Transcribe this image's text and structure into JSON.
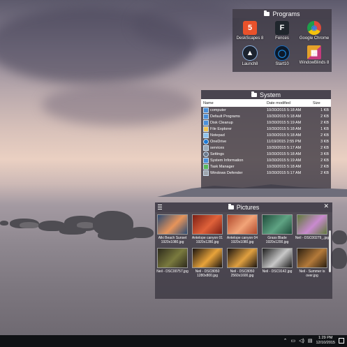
{
  "colors": {
    "fence_bg": "#3a3640",
    "taskbar": "#101215"
  },
  "programs": {
    "title": "Programs",
    "items": [
      {
        "label": "DeskScapes 8",
        "icon": "deskscapes-icon",
        "color": "#e9522b",
        "glyph": "5"
      },
      {
        "label": "Fences",
        "icon": "fences-icon",
        "color": "#20262d",
        "glyph": "F"
      },
      {
        "label": "Google Chrome",
        "icon": "chrome-icon",
        "color": "#de4a3a",
        "glyph": "◉"
      },
      {
        "label": "Launch8",
        "icon": "launch8-icon",
        "color": "#1d2430",
        "glyph": "▲"
      },
      {
        "label": "Start10",
        "icon": "start10-icon",
        "color": "#1b6ec2",
        "glyph": "◯"
      },
      {
        "label": "WindowBlinds 8",
        "icon": "windowblinds-icon",
        "color": "#e5a22a",
        "glyph": "▦"
      }
    ]
  },
  "system": {
    "title": "System",
    "columns": [
      "Name",
      "Date modified",
      "Size"
    ],
    "rows": [
      {
        "name": "computer",
        "date": "10/30/2015 5:18 AM",
        "size": "1 KB"
      },
      {
        "name": "Default Programs",
        "date": "10/30/2015 5:18 AM",
        "size": "2 KB"
      },
      {
        "name": "Disk Cleanup",
        "date": "10/30/2015 5:19 AM",
        "size": "2 KB"
      },
      {
        "name": "File Explorer",
        "date": "10/30/2015 5:18 AM",
        "size": "1 KB"
      },
      {
        "name": "Notepad",
        "date": "10/30/2015 5:18 AM",
        "size": "2 KB"
      },
      {
        "name": "OneDrive",
        "date": "11/19/2015 2:55 PM",
        "size": "3 KB"
      },
      {
        "name": "services",
        "date": "10/30/2015 5:17 AM",
        "size": "2 KB"
      },
      {
        "name": "Settings",
        "date": "10/30/2015 5:18 AM",
        "size": "3 KB"
      },
      {
        "name": "System Information",
        "date": "10/30/2015 5:19 AM",
        "size": "2 KB"
      },
      {
        "name": "Task Manager",
        "date": "10/30/2015 5:18 AM",
        "size": "2 KB"
      },
      {
        "name": "Windows Defender",
        "date": "10/30/2015 5:17 AM",
        "size": "2 KB"
      }
    ]
  },
  "pictures": {
    "title": "Pictures",
    "items": [
      {
        "label": "Alki Beach Sunset 1920x1080.jpg",
        "c1": "#2a4b74",
        "c2": "#e7945a"
      },
      {
        "label": "Antelope canyon 01 1920x1280.jpg",
        "c1": "#7a1e14",
        "c2": "#e0623a"
      },
      {
        "label": "Antelope canyon 04 1920x1080.jpg",
        "c1": "#b0482c",
        "c2": "#f2a478"
      },
      {
        "label": "Grass Blade 1920x1200.jpg",
        "c1": "#1e4a3a",
        "c2": "#5fa383"
      },
      {
        "label": "Neil - DSC00279_.jpg",
        "c1": "#5f7a3a",
        "c2": "#c98ad0"
      },
      {
        "label": "Neil - DSC00757.jpg",
        "c1": "#2d2a1c",
        "c2": "#7a7a3e"
      },
      {
        "label": "Neil - DSC8050 1280x800.jpg",
        "c1": "#1a1410",
        "c2": "#e8a33a"
      },
      {
        "label": "Neil - DSC8050 2560x1600.jpg",
        "c1": "#1a1410",
        "c2": "#e0a040"
      },
      {
        "label": "Neil - DSC9142.jpg",
        "c1": "#1e1e1e",
        "c2": "#c8c8c8"
      },
      {
        "label": "Neil - Summer is over.jpg",
        "c1": "#2a1e10",
        "c2": "#b47a3a"
      }
    ]
  },
  "taskbar": {
    "time": "1:29 PM",
    "date": "12/10/2015",
    "tray_icons": [
      "chevron-up-icon",
      "network-icon",
      "volume-icon",
      "keyboard-icon"
    ]
  }
}
